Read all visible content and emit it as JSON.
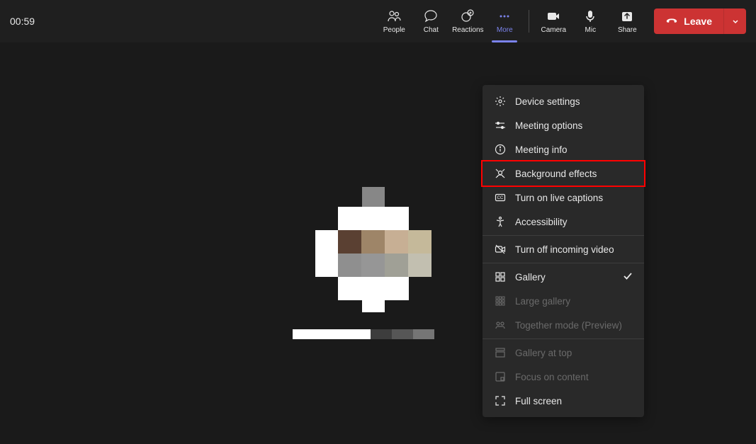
{
  "timer": "00:59",
  "toolbar": {
    "people_label": "People",
    "chat_label": "Chat",
    "reactions_label": "Reactions",
    "more_label": "More",
    "camera_label": "Camera",
    "mic_label": "Mic",
    "share_label": "Share",
    "leave_label": "Leave"
  },
  "more_menu": {
    "sections": [
      {
        "items": [
          {
            "label": "Device settings",
            "icon": "gear-icon",
            "enabled": true,
            "highlighted": false
          },
          {
            "label": "Meeting options",
            "icon": "sliders-icon",
            "enabled": true,
            "highlighted": false
          },
          {
            "label": "Meeting info",
            "icon": "info-icon",
            "enabled": true,
            "highlighted": false
          },
          {
            "label": "Background effects",
            "icon": "background-icon",
            "enabled": true,
            "highlighted": true
          },
          {
            "label": "Turn on live captions",
            "icon": "cc-icon",
            "enabled": true,
            "highlighted": false
          },
          {
            "label": "Accessibility",
            "icon": "accessibility-icon",
            "enabled": true,
            "highlighted": false
          }
        ]
      },
      {
        "items": [
          {
            "label": "Turn off incoming video",
            "icon": "video-off-icon",
            "enabled": true,
            "highlighted": false
          }
        ]
      },
      {
        "items": [
          {
            "label": "Gallery",
            "icon": "gallery-icon",
            "enabled": true,
            "highlighted": false,
            "checked": true
          },
          {
            "label": "Large gallery",
            "icon": "large-gallery-icon",
            "enabled": false,
            "highlighted": false
          },
          {
            "label": "Together mode (Preview)",
            "icon": "together-icon",
            "enabled": false,
            "highlighted": false
          }
        ]
      },
      {
        "items": [
          {
            "label": "Gallery at top",
            "icon": "gallery-top-icon",
            "enabled": false,
            "highlighted": false
          },
          {
            "label": "Focus on content",
            "icon": "focus-icon",
            "enabled": false,
            "highlighted": false
          },
          {
            "label": "Full screen",
            "icon": "fullscreen-icon",
            "enabled": true,
            "highlighted": false
          }
        ]
      }
    ]
  }
}
